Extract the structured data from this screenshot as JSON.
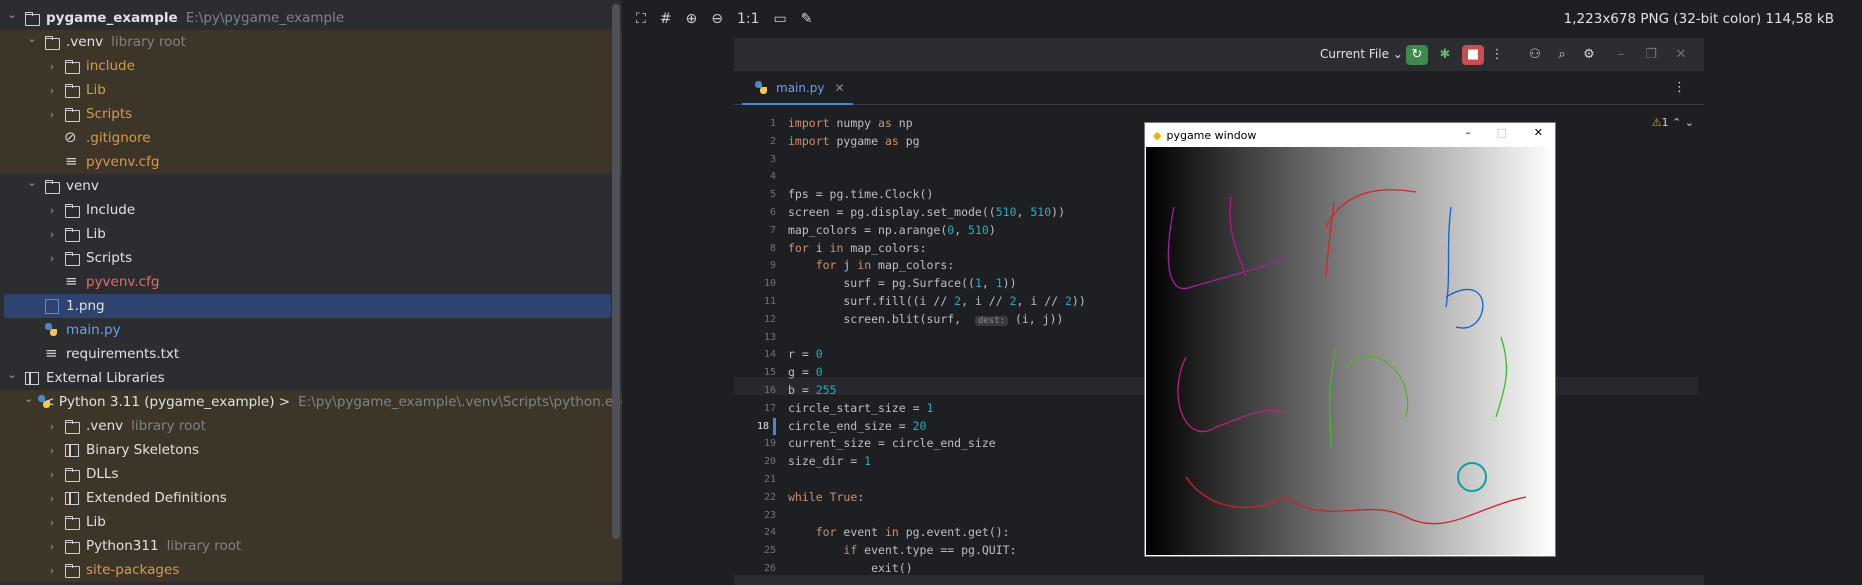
{
  "tree": [
    {
      "label": "pygame_example",
      "hint": "E:\\py\\pygame_example",
      "bold": true
    },
    {
      "label": ".venv",
      "hint": "library root"
    },
    {
      "label": "include"
    },
    {
      "label": "Lib"
    },
    {
      "label": "Scripts"
    },
    {
      "label": ".gitignore"
    },
    {
      "label": "pyvenv.cfg"
    },
    {
      "label": "venv"
    },
    {
      "label": "Include"
    },
    {
      "label": "Lib"
    },
    {
      "label": "Scripts"
    },
    {
      "label": "pyvenv.cfg"
    },
    {
      "label": "1.png"
    },
    {
      "label": "main.py"
    },
    {
      "label": "requirements.txt"
    },
    {
      "label": "External Libraries"
    },
    {
      "label": "< Python 3.11 (pygame_example) >",
      "hint": "E:\\py\\pygame_example\\.venv\\Scripts\\python.exe"
    },
    {
      "label": ".venv",
      "hint": "library root"
    },
    {
      "label": "Binary Skeletons"
    },
    {
      "label": "DLLs"
    },
    {
      "label": "Extended Definitions"
    },
    {
      "label": "Lib"
    },
    {
      "label": "Python311",
      "hint": "library root"
    },
    {
      "label": "site-packages"
    }
  ],
  "image_viewer": {
    "zoom_label": "1:1",
    "info": "1,223x678 PNG (32-bit color) 114,58 kB"
  },
  "ide": {
    "run_config": "Current File",
    "tab": "main.py",
    "warnings": "1",
    "code": [
      "import numpy as np",
      "import pygame as pg",
      "",
      "",
      "fps = pg.time.Clock()",
      "screen = pg.display.set_mode((510, 510))",
      "map_colors = np.arange(0, 510)",
      "for i in map_colors:",
      "    for j in map_colors:",
      "        surf = pg.Surface((1, 1))",
      "        surf.fill((i // 2, i // 2, i // 2))",
      "        screen.blit(surf,  dest: (i, j))",
      "",
      "r = 0",
      "g = 0",
      "b = 255",
      "circle_start_size = 1",
      "circle_end_size = 20",
      "current_size = circle_end_size",
      "size_dir = 1",
      "",
      "while True:",
      "",
      "    for event in pg.event.get():",
      "        if event.type == pg.QUIT:",
      "            exit()"
    ],
    "current_line": 18
  },
  "pygame_window": {
    "title": "pygame window"
  }
}
